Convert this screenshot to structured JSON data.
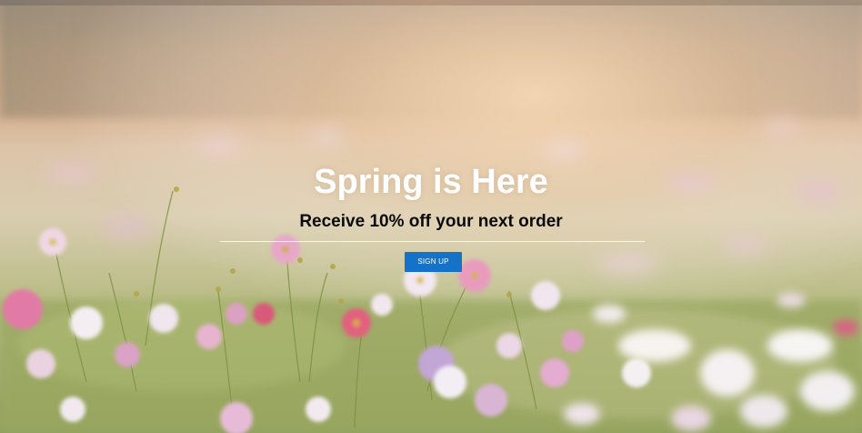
{
  "hero": {
    "title": "Spring is Here",
    "subtitle": "Receive 10% off your next order",
    "cta_label": "SIGN UP",
    "background_image": "spring flower field photo (pink and white cosmos flowers, warm sunlight)"
  },
  "colors": {
    "button": "#1473c9",
    "title": "#ffffff",
    "subtitle": "#0a0a0a",
    "divider": "#ffffff"
  }
}
